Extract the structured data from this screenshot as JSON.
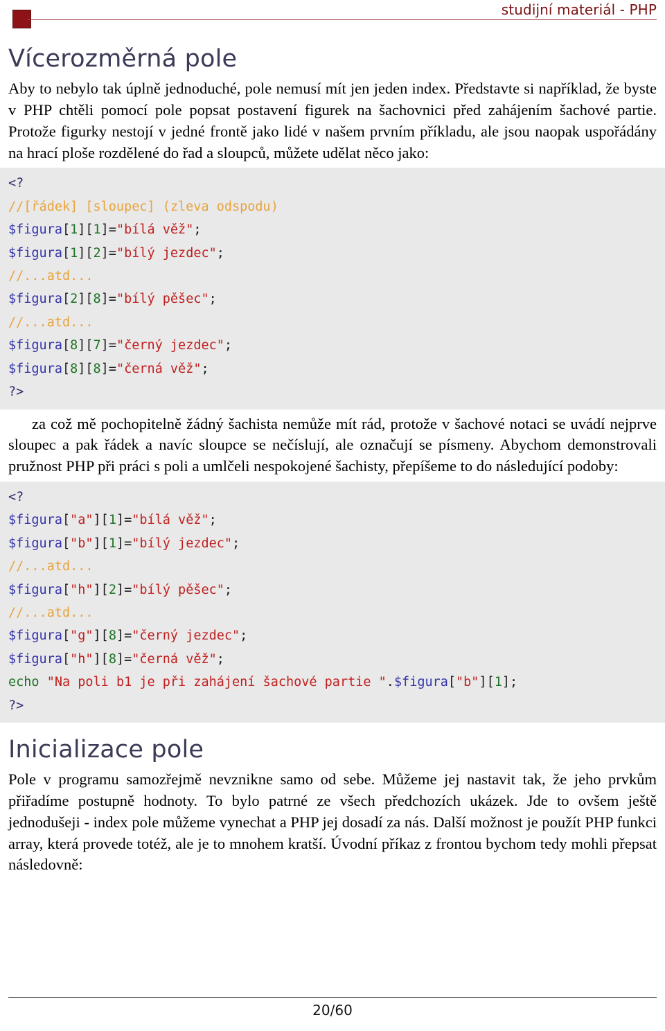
{
  "header": {
    "title": "studijní materiál - PHP",
    "accent_color": "#7b1113",
    "marker_color": "#8d1318"
  },
  "sections": [
    {
      "heading": "Vícerozměrná pole",
      "paragraph": "Aby to nebylo tak úplně jednoduché, pole nemusí mít jen jeden index. Představte si například, že byste v PHP chtěli pomocí pole popsat postavení figurek na šachovnici před zahájením šachové partie. Protože figurky nestojí v jedné frontě jako lidé v našem prvním příkladu, ale jsou naopak uspořádány na hrací ploše rozdělené do řad a sloupců, můžete udělat něco jako:"
    }
  ],
  "code_block_1": {
    "lines": [
      [
        {
          "t": "tag",
          "s": "<?"
        }
      ],
      [
        {
          "t": "cmt",
          "s": "//[řádek] [sloupec] (zleva odspodu)"
        }
      ],
      [
        {
          "t": "var",
          "s": "$figura"
        },
        {
          "t": "punc",
          "s": "["
        },
        {
          "t": "num",
          "s": "1"
        },
        {
          "t": "punc",
          "s": "]["
        },
        {
          "t": "num",
          "s": "1"
        },
        {
          "t": "punc",
          "s": "]="
        },
        {
          "t": "str",
          "s": "\"bílá věž\""
        },
        {
          "t": "punc",
          "s": ";"
        }
      ],
      [
        {
          "t": "var",
          "s": "$figura"
        },
        {
          "t": "punc",
          "s": "["
        },
        {
          "t": "num",
          "s": "1"
        },
        {
          "t": "punc",
          "s": "]["
        },
        {
          "t": "num",
          "s": "2"
        },
        {
          "t": "punc",
          "s": "]="
        },
        {
          "t": "str",
          "s": "\"bílý jezdec\""
        },
        {
          "t": "punc",
          "s": ";"
        }
      ],
      [
        {
          "t": "cmt",
          "s": "//...atd..."
        }
      ],
      [
        {
          "t": "var",
          "s": "$figura"
        },
        {
          "t": "punc",
          "s": "["
        },
        {
          "t": "num",
          "s": "2"
        },
        {
          "t": "punc",
          "s": "]["
        },
        {
          "t": "num",
          "s": "8"
        },
        {
          "t": "punc",
          "s": "]="
        },
        {
          "t": "str",
          "s": "\"bílý pěšec\""
        },
        {
          "t": "punc",
          "s": ";"
        }
      ],
      [
        {
          "t": "cmt",
          "s": "//...atd..."
        }
      ],
      [
        {
          "t": "var",
          "s": "$figura"
        },
        {
          "t": "punc",
          "s": "["
        },
        {
          "t": "num",
          "s": "8"
        },
        {
          "t": "punc",
          "s": "]["
        },
        {
          "t": "num",
          "s": "7"
        },
        {
          "t": "punc",
          "s": "]="
        },
        {
          "t": "str",
          "s": "\"černý jezdec\""
        },
        {
          "t": "punc",
          "s": ";"
        }
      ],
      [
        {
          "t": "var",
          "s": "$figura"
        },
        {
          "t": "punc",
          "s": "["
        },
        {
          "t": "num",
          "s": "8"
        },
        {
          "t": "punc",
          "s": "]["
        },
        {
          "t": "num",
          "s": "8"
        },
        {
          "t": "punc",
          "s": "]="
        },
        {
          "t": "str",
          "s": "\"černá věž\""
        },
        {
          "t": "punc",
          "s": ";"
        }
      ],
      [
        {
          "t": "tag",
          "s": "?>"
        }
      ]
    ]
  },
  "paragraph_2": "za což mě pochopitelně žádný šachista nemůže mít rád, protože v šachové notaci se uvádí nejprve sloupec a pak řádek a navíc sloupce se nečíslují, ale označují se písmeny. Abychom demonstrovali pružnost PHP při práci s poli a umlčeli nespokojené šachisty, přepíšeme to do následující podoby:",
  "code_block_2": {
    "lines": [
      [
        {
          "t": "tag",
          "s": "<?"
        }
      ],
      [
        {
          "t": "var",
          "s": "$figura"
        },
        {
          "t": "punc",
          "s": "["
        },
        {
          "t": "str",
          "s": "\"a\""
        },
        {
          "t": "punc",
          "s": "]["
        },
        {
          "t": "num",
          "s": "1"
        },
        {
          "t": "punc",
          "s": "]="
        },
        {
          "t": "str",
          "s": "\"bílá věž\""
        },
        {
          "t": "punc",
          "s": ";"
        }
      ],
      [
        {
          "t": "var",
          "s": "$figura"
        },
        {
          "t": "punc",
          "s": "["
        },
        {
          "t": "str",
          "s": "\"b\""
        },
        {
          "t": "punc",
          "s": "]["
        },
        {
          "t": "num",
          "s": "1"
        },
        {
          "t": "punc",
          "s": "]="
        },
        {
          "t": "str",
          "s": "\"bílý jezdec\""
        },
        {
          "t": "punc",
          "s": ";"
        }
      ],
      [
        {
          "t": "cmt",
          "s": "//...atd..."
        }
      ],
      [
        {
          "t": "var",
          "s": "$figura"
        },
        {
          "t": "punc",
          "s": "["
        },
        {
          "t": "str",
          "s": "\"h\""
        },
        {
          "t": "punc",
          "s": "]["
        },
        {
          "t": "num",
          "s": "2"
        },
        {
          "t": "punc",
          "s": "]="
        },
        {
          "t": "str",
          "s": "\"bílý pěšec\""
        },
        {
          "t": "punc",
          "s": ";"
        }
      ],
      [
        {
          "t": "cmt",
          "s": "//...atd..."
        }
      ],
      [
        {
          "t": "var",
          "s": "$figura"
        },
        {
          "t": "punc",
          "s": "["
        },
        {
          "t": "str",
          "s": "\"g\""
        },
        {
          "t": "punc",
          "s": "]["
        },
        {
          "t": "num",
          "s": "8"
        },
        {
          "t": "punc",
          "s": "]="
        },
        {
          "t": "str",
          "s": "\"černý jezdec\""
        },
        {
          "t": "punc",
          "s": ";"
        }
      ],
      [
        {
          "t": "var",
          "s": "$figura"
        },
        {
          "t": "punc",
          "s": "["
        },
        {
          "t": "str",
          "s": "\"h\""
        },
        {
          "t": "punc",
          "s": "]["
        },
        {
          "t": "num",
          "s": "8"
        },
        {
          "t": "punc",
          "s": "]="
        },
        {
          "t": "str",
          "s": "\"černá věž\""
        },
        {
          "t": "punc",
          "s": ";"
        }
      ],
      [
        {
          "t": "kw",
          "s": "echo "
        },
        {
          "t": "str",
          "s": "\"Na poli b1 je při zahájení šachové partie \""
        },
        {
          "t": "punc",
          "s": "."
        },
        {
          "t": "var",
          "s": "$figura"
        },
        {
          "t": "punc",
          "s": "["
        },
        {
          "t": "str",
          "s": "\"b\""
        },
        {
          "t": "punc",
          "s": "]["
        },
        {
          "t": "num",
          "s": "1"
        },
        {
          "t": "punc",
          "s": "];"
        }
      ],
      [
        {
          "t": "tag",
          "s": "?>"
        }
      ]
    ]
  },
  "section_2": {
    "heading": "Inicializace pole",
    "paragraph": "Pole v programu samozřejmě nevznikne samo od sebe. Můžeme jej nastavit tak, že jeho prvkům přiřadíme postupně hodnoty. To bylo patrné ze všech předchozích ukázek. Jde to ovšem ještě jednodušeji - index pole můžeme vynechat a PHP jej dosadí za nás. Další možnost je použít PHP funkci array, která provede totéž, ale je to mnohem kratší. Úvodní příkaz z frontou bychom tedy mohli přepsat následovně:"
  },
  "footer": {
    "page_label": "20/60"
  }
}
